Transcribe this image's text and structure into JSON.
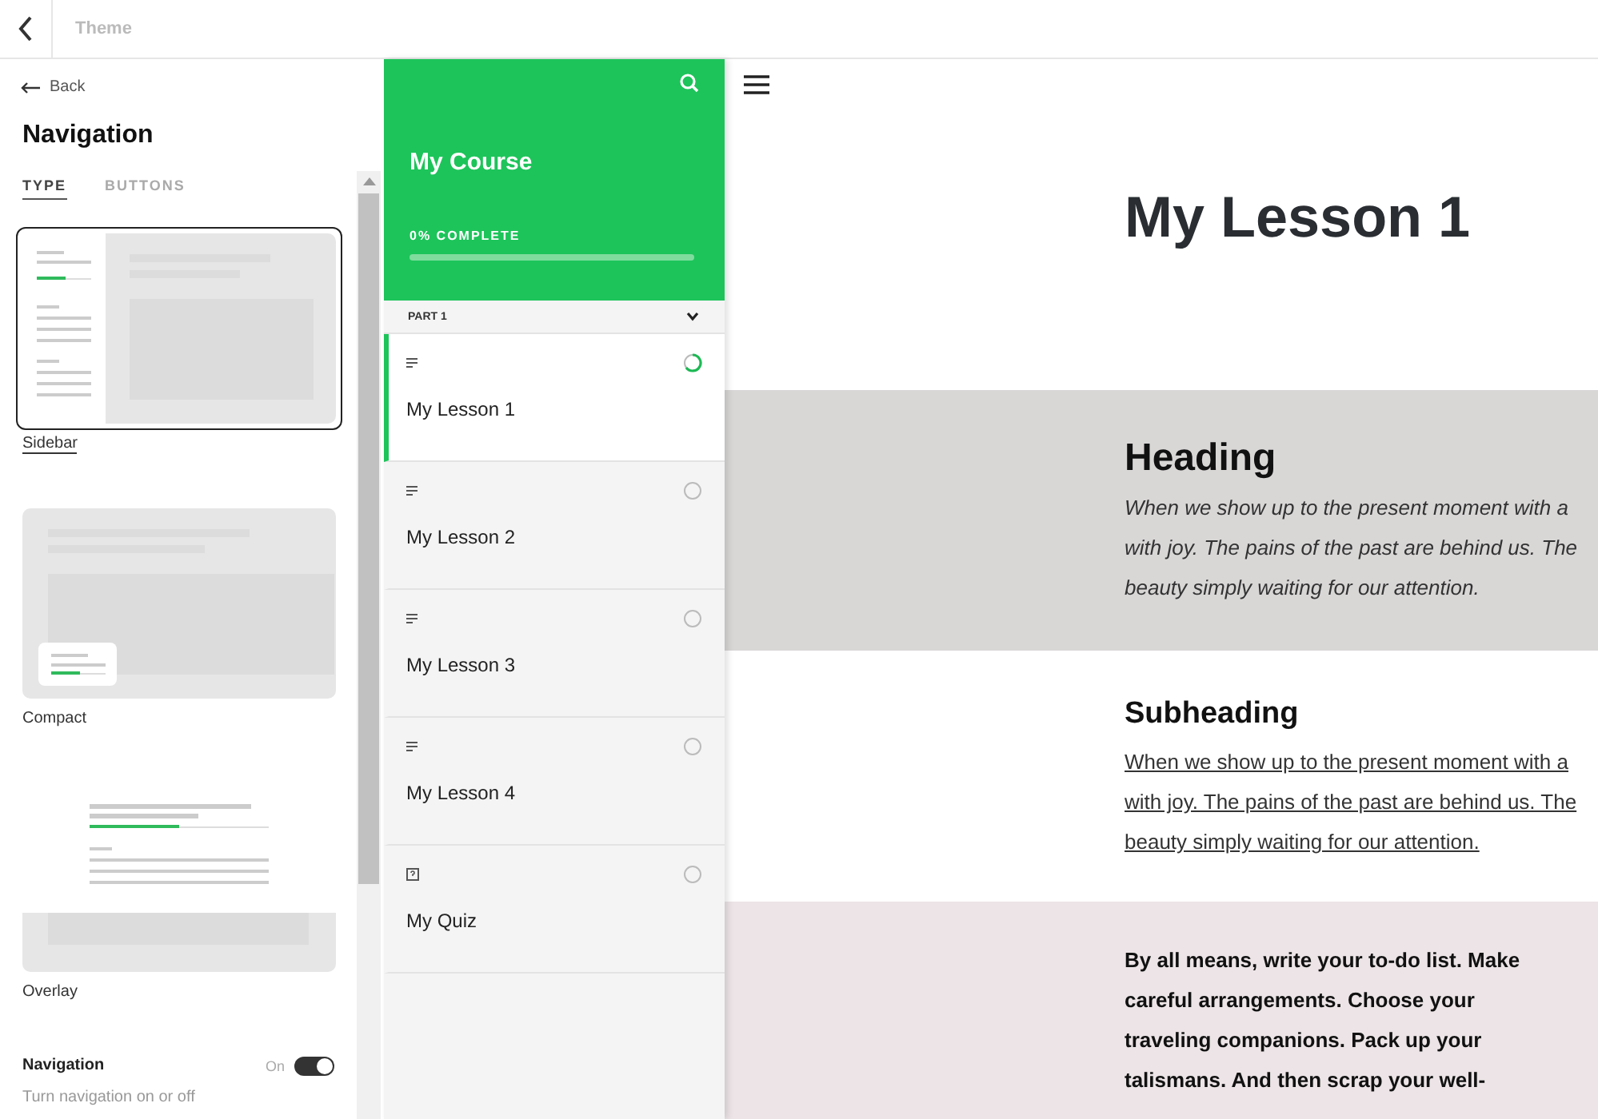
{
  "top_bar": {
    "title": "Theme"
  },
  "settings": {
    "back": "Back",
    "title": "Navigation",
    "tabs": [
      {
        "label": "TYPE",
        "selected": true
      },
      {
        "label": "BUTTONS",
        "selected": false
      }
    ],
    "layouts": [
      {
        "kind": "sidebar",
        "label": "Sidebar",
        "selected": true
      },
      {
        "kind": "compact",
        "label": "Compact",
        "selected": false
      },
      {
        "kind": "overlay",
        "label": "Overlay",
        "selected": false
      }
    ],
    "toggle": {
      "label": "Navigation",
      "state_text": "On",
      "on": true,
      "description": "Turn navigation on or off"
    }
  },
  "course": {
    "title": "My Course",
    "progress_text": "0% COMPLETE",
    "level": 0,
    "section": {
      "title": "PART 1",
      "expanded": true
    },
    "items": [
      {
        "kind": "lesson",
        "title": "My Lesson 1",
        "selected": true,
        "in_progress": true
      },
      {
        "kind": "lesson",
        "title": "My Lesson 2",
        "selected": false,
        "in_progress": false
      },
      {
        "kind": "lesson",
        "title": "My Lesson 3",
        "selected": false,
        "in_progress": false
      },
      {
        "kind": "lesson",
        "title": "My Lesson 4",
        "selected": false,
        "in_progress": false
      },
      {
        "kind": "quiz",
        "title": "My Quiz",
        "selected": false,
        "in_progress": false
      }
    ]
  },
  "lesson": {
    "title": "My Lesson 1",
    "blocks": [
      {
        "kind": "heading",
        "title": "Heading",
        "lines": [
          "When we show up to the present moment with a",
          "with joy. The pains of the past are behind us. The",
          "beauty simply waiting for our attention."
        ]
      },
      {
        "kind": "subheading",
        "title": "Subheading",
        "lines": [
          "When we show up to the present moment with a",
          "with joy. The pains of the past are behind us. The",
          "beauty simply waiting for our attention."
        ]
      },
      {
        "kind": "text",
        "lines": [
          "By all means, write your to-do list. Make",
          "careful arrangements. Choose your",
          "traveling companions. Pack up your",
          "talismans. And then scrap your well-"
        ]
      }
    ]
  }
}
